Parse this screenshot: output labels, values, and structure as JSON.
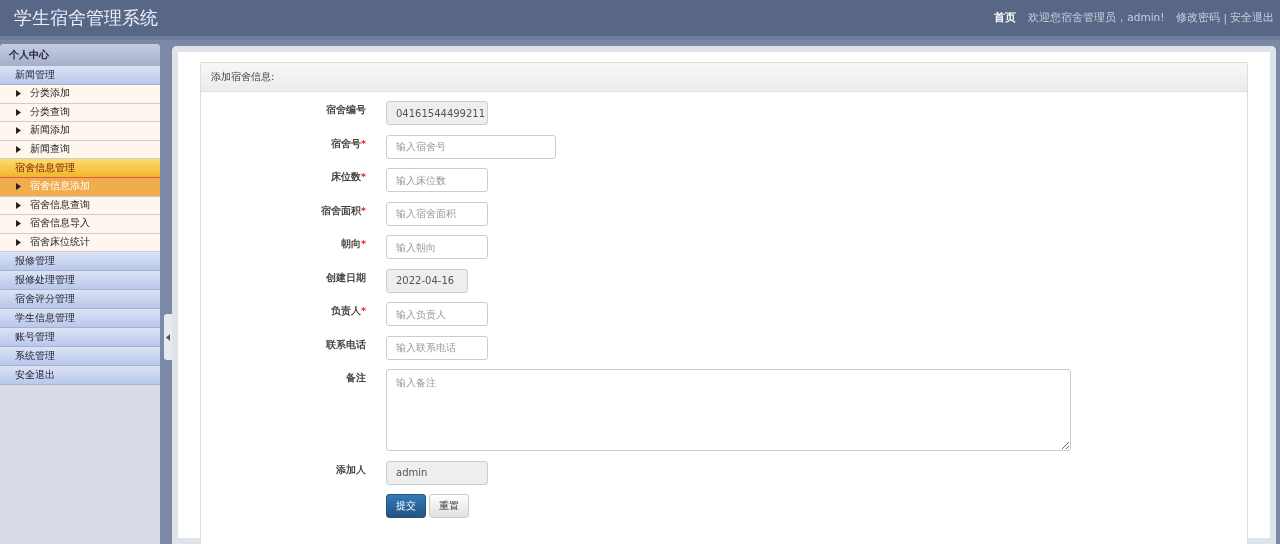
{
  "header": {
    "title": "学生宿舍管理系统",
    "home": "首页",
    "welcome": "欢迎您宿舍管理员，admin!",
    "change_password": "修改密码",
    "separator": "|",
    "logout": "安全退出"
  },
  "sidebar": {
    "title": "个人中心",
    "groups": [
      {
        "label": "新闻管理",
        "selected": false,
        "expanded": true,
        "children": [
          {
            "label": "分类添加",
            "selected": false
          },
          {
            "label": "分类查询",
            "selected": false
          },
          {
            "label": "新闻添加",
            "selected": false
          },
          {
            "label": "新闻查询",
            "selected": false
          }
        ]
      },
      {
        "label": "宿舍信息管理",
        "selected": true,
        "expanded": true,
        "children": [
          {
            "label": "宿舍信息添加",
            "selected": true
          },
          {
            "label": "宿舍信息查询",
            "selected": false
          },
          {
            "label": "宿舍信息导入",
            "selected": false
          },
          {
            "label": "宿舍床位统计",
            "selected": false
          }
        ]
      },
      {
        "label": "报修管理",
        "selected": false
      },
      {
        "label": "报修处理管理",
        "selected": false
      },
      {
        "label": "宿舍评分管理",
        "selected": false
      },
      {
        "label": "学生信息管理",
        "selected": false
      },
      {
        "label": "账号管理",
        "selected": false
      },
      {
        "label": "系统管理",
        "selected": false
      },
      {
        "label": "安全退出",
        "selected": false
      }
    ]
  },
  "form": {
    "title": "添加宿舍信息:",
    "fields": [
      {
        "label": "宿舍编号",
        "kind": "readonly",
        "value": "04161544499211"
      },
      {
        "label": "宿舍号",
        "required_mark": "*",
        "kind": "input",
        "placeholder": "输入宿舍号"
      },
      {
        "label": "床位数",
        "required_mark": "*",
        "kind": "input",
        "placeholder": "输入床位数"
      },
      {
        "label": "宿舍面积",
        "required_mark": "*",
        "kind": "input",
        "placeholder": "输入宿舍面积"
      },
      {
        "label": "朝向",
        "required_mark": "*",
        "kind": "input",
        "placeholder": "输入朝向"
      },
      {
        "label": "创建日期",
        "kind": "readonly",
        "value": "2022-04-16"
      },
      {
        "label": "负责人",
        "required_mark": "*",
        "kind": "input",
        "placeholder": "输入负责人"
      },
      {
        "label": "联系电话",
        "kind": "input",
        "placeholder": "输入联系电话"
      },
      {
        "label": "备注",
        "kind": "textarea",
        "placeholder": "输入备注"
      },
      {
        "label": "添加人",
        "kind": "readonly",
        "value": "admin"
      }
    ],
    "buttons": [
      {
        "label": "提交",
        "kind": "primary"
      },
      {
        "label": "重置",
        "kind": "default"
      }
    ]
  }
}
